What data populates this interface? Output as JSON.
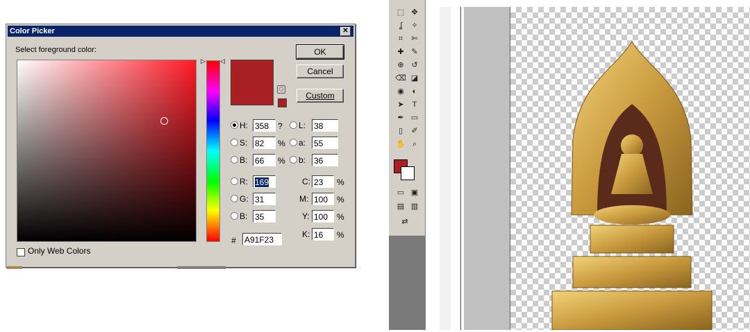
{
  "dialog": {
    "title": "Color Picker",
    "close_glyph": "✕",
    "prompt": "Select foreground color:",
    "buttons": {
      "ok": "OK",
      "cancel": "Cancel",
      "custom": "Custom"
    },
    "current_color": "#a91f23",
    "hsb": {
      "h_label": "H:",
      "h_value": "358",
      "h_unit": "?",
      "s_label": "S:",
      "s_value": "82",
      "s_unit": "%",
      "b_label": "B:",
      "b_value": "66",
      "b_unit": "%"
    },
    "lab": {
      "l_label": "L:",
      "l_value": "38",
      "a_label": "a:",
      "a_value": "55",
      "b_label": "b:",
      "b_value": "36"
    },
    "rgb": {
      "r_label": "R:",
      "r_value": "169",
      "g_label": "G:",
      "g_value": "31",
      "b_label": "B:",
      "b_value": "35"
    },
    "cmyk": {
      "c_label": "C:",
      "c_value": "23",
      "m_label": "M:",
      "m_value": "100",
      "y_label": "Y:",
      "y_value": "100",
      "k_label": "K:",
      "k_value": "16",
      "unit": "%"
    },
    "hex_label": "#",
    "hex_value": "A91F23",
    "only_web_colors": "Only Web Colors"
  },
  "photoshop": {
    "foreground_color": "#a91f23",
    "background_color": "#ffffff",
    "tool_icons": [
      "marquee-icon",
      "move-icon",
      "lasso-icon",
      "magic-wand-icon",
      "crop-icon",
      "slice-icon",
      "healing-brush-icon",
      "brush-icon",
      "clone-stamp-icon",
      "history-brush-icon",
      "eraser-icon",
      "paint-bucket-icon",
      "blur-icon",
      "dodge-icon",
      "path-selection-icon",
      "type-icon",
      "pen-icon",
      "shape-icon",
      "notes-icon",
      "eyedropper-icon",
      "hand-icon",
      "zoom-icon"
    ]
  }
}
